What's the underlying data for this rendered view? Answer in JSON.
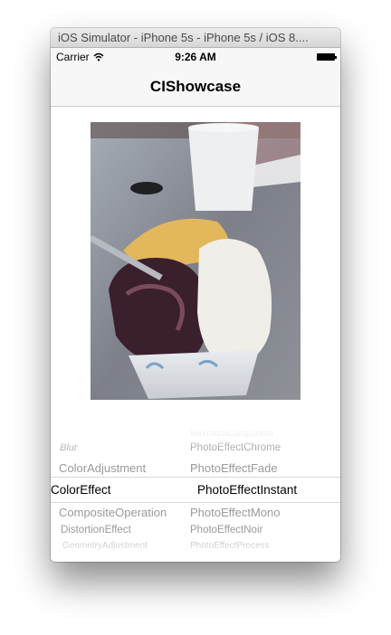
{
  "window": {
    "title": "iOS Simulator - iPhone 5s - iPhone 5s / iOS 8...."
  },
  "status_bar": {
    "carrier": "Carrier",
    "time": "9:26 AM"
  },
  "nav_bar": {
    "title": "CIShowcase"
  },
  "photo": {
    "description_icon": "ice-cream-photo"
  },
  "picker": {
    "left_column": {
      "rows": [
        "Blur",
        "ColorAdjustment",
        "ColorEffect",
        "CompositeOperation",
        "DistortionEffect",
        "GeometryAdjustment"
      ],
      "selected": "ColorEffect"
    },
    "right_column": {
      "rows": [
        "MinimumComponent",
        "PhotoEffectChrome",
        "PhotoEffectFade",
        "PhotoEffectInstant",
        "PhotoEffectMono",
        "PhotoEffectNoir",
        "PhotoEffectProcess"
      ],
      "selected": "PhotoEffectInstant"
    }
  },
  "colors": {
    "selected_text": "#000000",
    "unselected_text": "#9a9a9a",
    "nav_bg": "#f7f7f7"
  }
}
